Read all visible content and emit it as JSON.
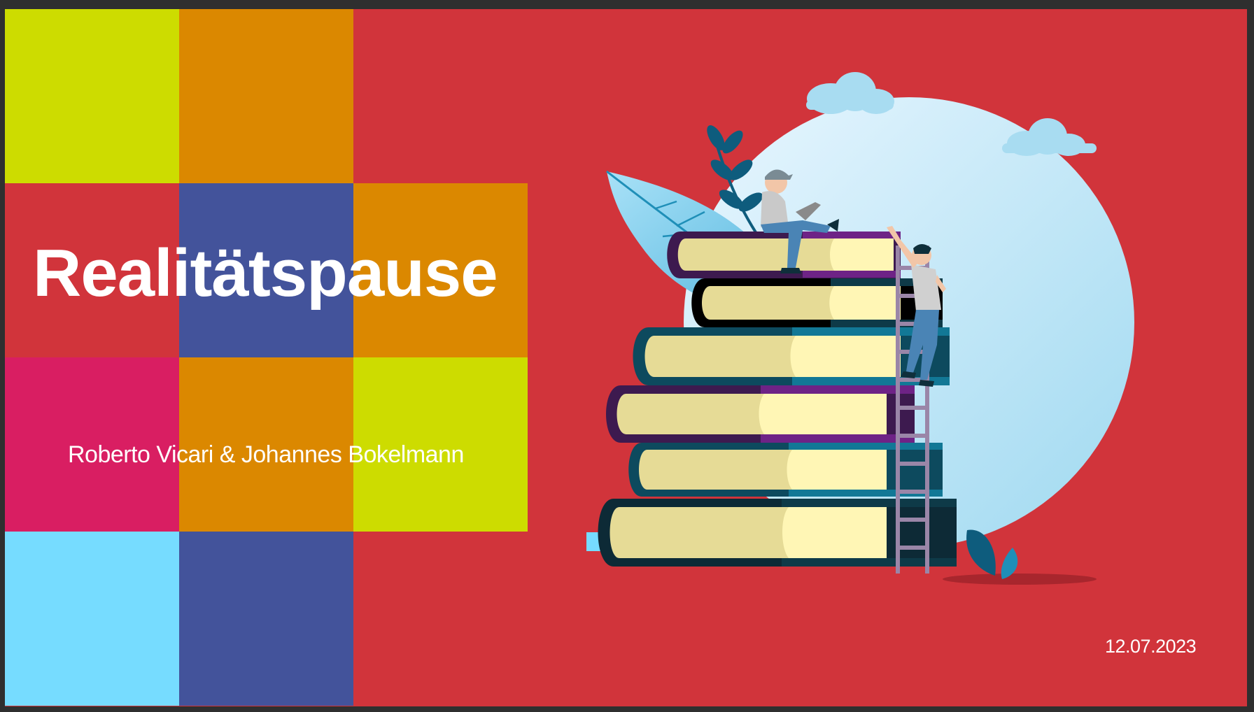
{
  "slide": {
    "title": "Realitätspause",
    "authors": "Roberto Vicari & Johannes Bokelmann",
    "date": "12.07.2023"
  },
  "colors": {
    "background": "#d1343b",
    "lime": "#cddc00",
    "orange": "#db8800",
    "blue": "#43539b",
    "pink": "#d91e62",
    "cyan": "#76dcff",
    "text": "#ffffff"
  },
  "illustration": {
    "icons": [
      "cloud-icon",
      "leaf-icon",
      "book-stack-icon",
      "ladder-icon",
      "person-reading-icon",
      "person-climbing-icon",
      "plant-icon"
    ]
  }
}
